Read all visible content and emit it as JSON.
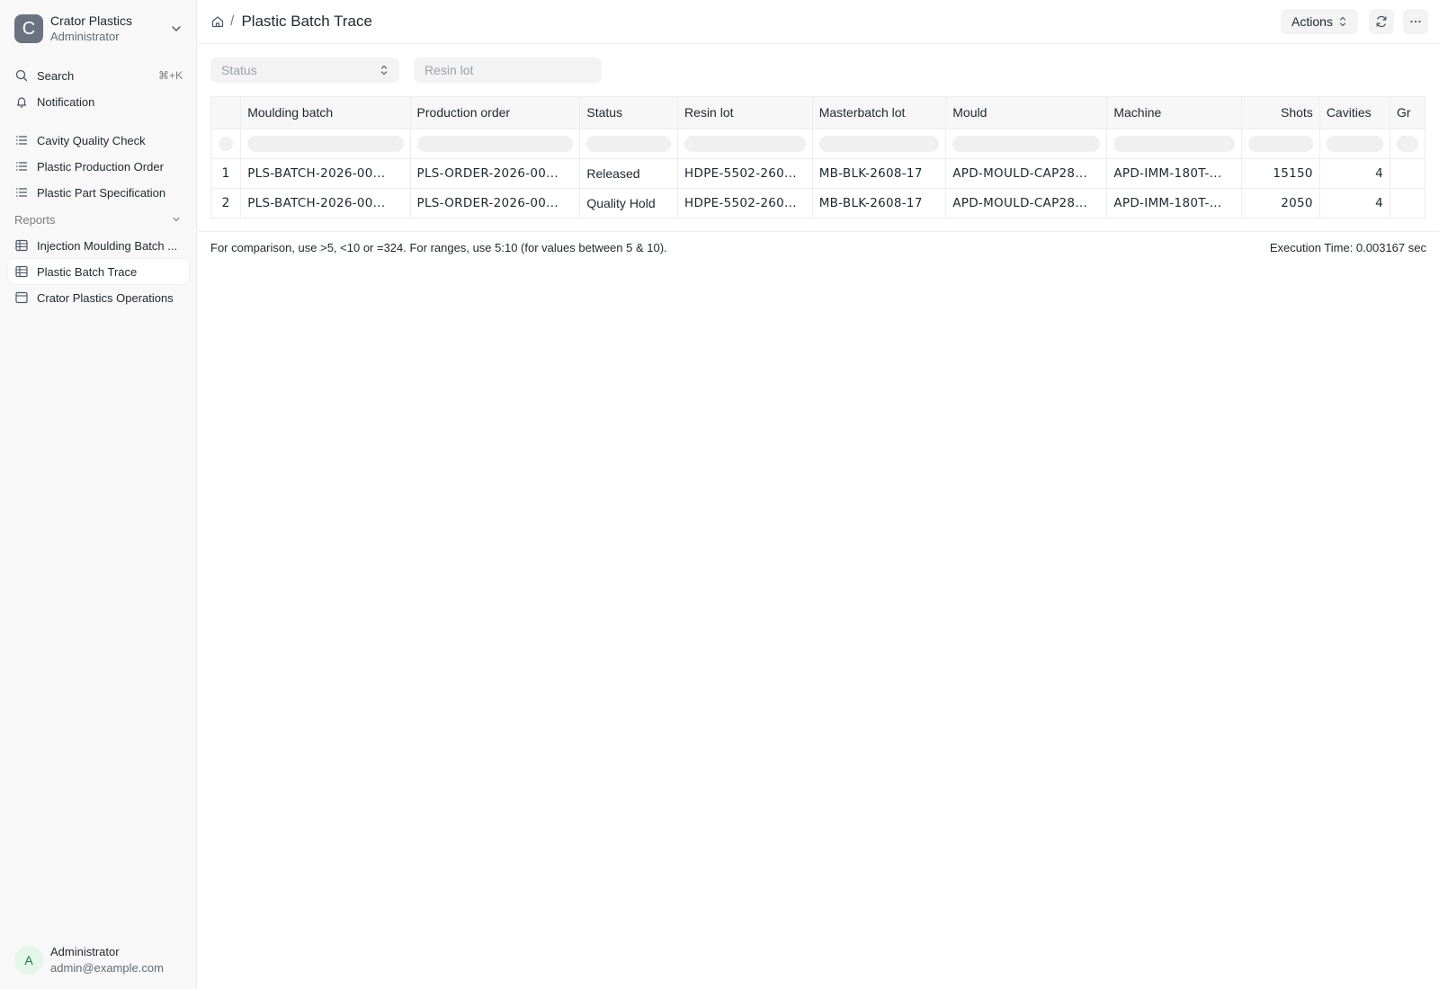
{
  "workspace": {
    "name": "Crator Plastics",
    "role": "Administrator",
    "logo_letter": "C"
  },
  "sidebar": {
    "search": {
      "label": "Search",
      "shortcut": "⌘+K"
    },
    "notification": {
      "label": "Notification"
    },
    "items": [
      {
        "label": "Cavity Quality Check",
        "icon": "list-icon"
      },
      {
        "label": "Plastic Production Order",
        "icon": "list-icon"
      },
      {
        "label": "Plastic Part Specification",
        "icon": "list-icon"
      }
    ],
    "reports_label": "Reports",
    "reports": [
      {
        "label": "Injection Moulding Batch ...",
        "icon": "table-icon"
      },
      {
        "label": "Plastic Batch Trace",
        "icon": "table-icon",
        "active": true
      },
      {
        "label": "Crator Plastics Operations",
        "icon": "dashboard-icon"
      }
    ]
  },
  "user": {
    "initial": "A",
    "name": "Administrator",
    "email": "admin@example.com"
  },
  "header": {
    "separator": "/",
    "title": "Plastic Batch Trace",
    "actions_label": "Actions"
  },
  "filters": {
    "status_placeholder": "Status",
    "resin_placeholder": "Resin lot"
  },
  "table": {
    "columns": [
      "Moulding batch",
      "Production order",
      "Status",
      "Resin lot",
      "Masterbatch lot",
      "Mould",
      "Machine",
      "Shots",
      "Cavities",
      "Gr"
    ],
    "rows": [
      {
        "idx": "1",
        "batch": "PLS-BATCH-2026-00...",
        "order": "PLS-ORDER-2026-00...",
        "status": "Released",
        "resin": "HDPE-5502-260...",
        "masterbatch": "MB-BLK-2608-17",
        "mould": "APD-MOULD-CAP28...",
        "machine": "APD-IMM-180T-...",
        "shots": "15150",
        "cavities": "4"
      },
      {
        "idx": "2",
        "batch": "PLS-BATCH-2026-00...",
        "order": "PLS-ORDER-2026-00...",
        "status": "Quality Hold",
        "resin": "HDPE-5502-260...",
        "masterbatch": "MB-BLK-2608-17",
        "mould": "APD-MOULD-CAP28...",
        "machine": "APD-IMM-180T-...",
        "shots": "2050",
        "cavities": "4"
      }
    ]
  },
  "footer": {
    "hint": "For comparison, use >5, <10 or =324. For ranges, use 5:10 (for values between 5 & 10).",
    "execution_time": "Execution Time: 0.003167 sec"
  }
}
